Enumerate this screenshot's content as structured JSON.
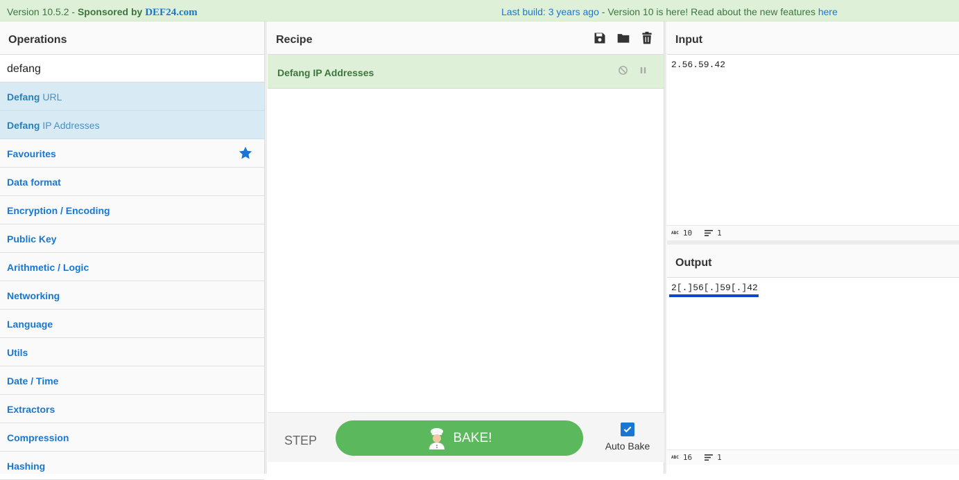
{
  "banner": {
    "version": "Version 10.5.2",
    "sep1": " - ",
    "sponsored_by": "Sponsored by ",
    "sponsor": "DEF24.com",
    "last_build": "Last build: 3 years ago",
    "sep2": " - ",
    "news": "Version 10 is here! Read about the new features ",
    "here_link": "here"
  },
  "operations": {
    "title": "Operations",
    "search_value": "defang",
    "results": [
      {
        "match": "Defang",
        "rest": " URL"
      },
      {
        "match": "Defang",
        "rest": " IP Addresses"
      }
    ],
    "categories": [
      "Favourites",
      "Data format",
      "Encryption / Encoding",
      "Public Key",
      "Arithmetic / Logic",
      "Networking",
      "Language",
      "Utils",
      "Date / Time",
      "Extractors",
      "Compression",
      "Hashing"
    ]
  },
  "recipe": {
    "title": "Recipe",
    "operation": "Defang IP Addresses",
    "step_label": "STEP",
    "bake_label": "BAKE!",
    "auto_bake_label": "Auto Bake",
    "auto_bake_checked": true
  },
  "input": {
    "title": "Input",
    "text": "2.56.59.42",
    "length": "10",
    "lines": "1"
  },
  "output": {
    "title": "Output",
    "text": "2[.]56[.]59[.]42",
    "length": "16",
    "lines": "1"
  },
  "colors": {
    "accent": "#1976d2",
    "banner_bg": "#dff0d8",
    "banner_text": "#3c763d",
    "bake_green": "#5cb85c",
    "highlight_bg": "#d8ebf5"
  }
}
